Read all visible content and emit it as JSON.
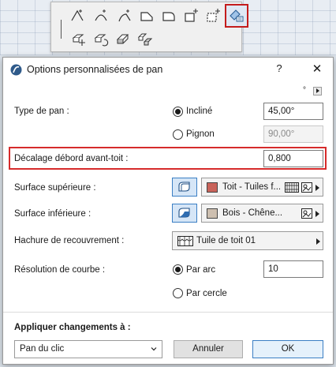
{
  "toolbar": {
    "tools": [
      {
        "name": "tool-roof-polygon-icon"
      },
      {
        "name": "tool-roof-curve-icon"
      },
      {
        "name": "tool-roof-curve-edge-icon"
      },
      {
        "name": "tool-roof-gable-icon"
      },
      {
        "name": "tool-roof-hip-icon"
      },
      {
        "name": "tool-roof-add-plane-icon"
      },
      {
        "name": "tool-roof-custom-icon"
      },
      {
        "name": "tool-roof-plane-settings-icon"
      },
      {
        "name": "tool-roof-move-icon"
      },
      {
        "name": "tool-roof-rotate-icon"
      },
      {
        "name": "tool-roof-edit-icon"
      },
      {
        "name": "tool-roof-group-icon"
      }
    ]
  },
  "dialog": {
    "title": "Options personnalisées de pan",
    "help_label": "?",
    "close_label": "✕",
    "degree_symbol": "°",
    "pan_type": {
      "label": "Type de pan :",
      "option_inclined": "Incliné",
      "inclined_value": "45,00°",
      "option_gable": "Pignon",
      "gable_value": "90,00°"
    },
    "eaves_offset": {
      "label": "Décalage débord avant-toit :",
      "value": "0,800"
    },
    "top_surface": {
      "label": "Surface supérieure :",
      "material": "Toit - Tuiles f...",
      "swatch_color": "#c9635a"
    },
    "bottom_surface": {
      "label": "Surface inférieure :",
      "material": "Bois - Chêne...",
      "swatch_color": "#cdbfb0"
    },
    "cover_fill": {
      "label": "Hachure de recouvrement :",
      "value": "Tuile de toit 01"
    },
    "curve_resolution": {
      "label": "Résolution de courbe :",
      "option_arc": "Par arc",
      "arc_value": "10",
      "option_circle": "Par cercle"
    },
    "apply": {
      "label": "Appliquer changements à :",
      "selected": "Pan du clic",
      "cancel_label": "Annuler",
      "ok_label": "OK"
    },
    "accent_color": "#d62b2b"
  }
}
